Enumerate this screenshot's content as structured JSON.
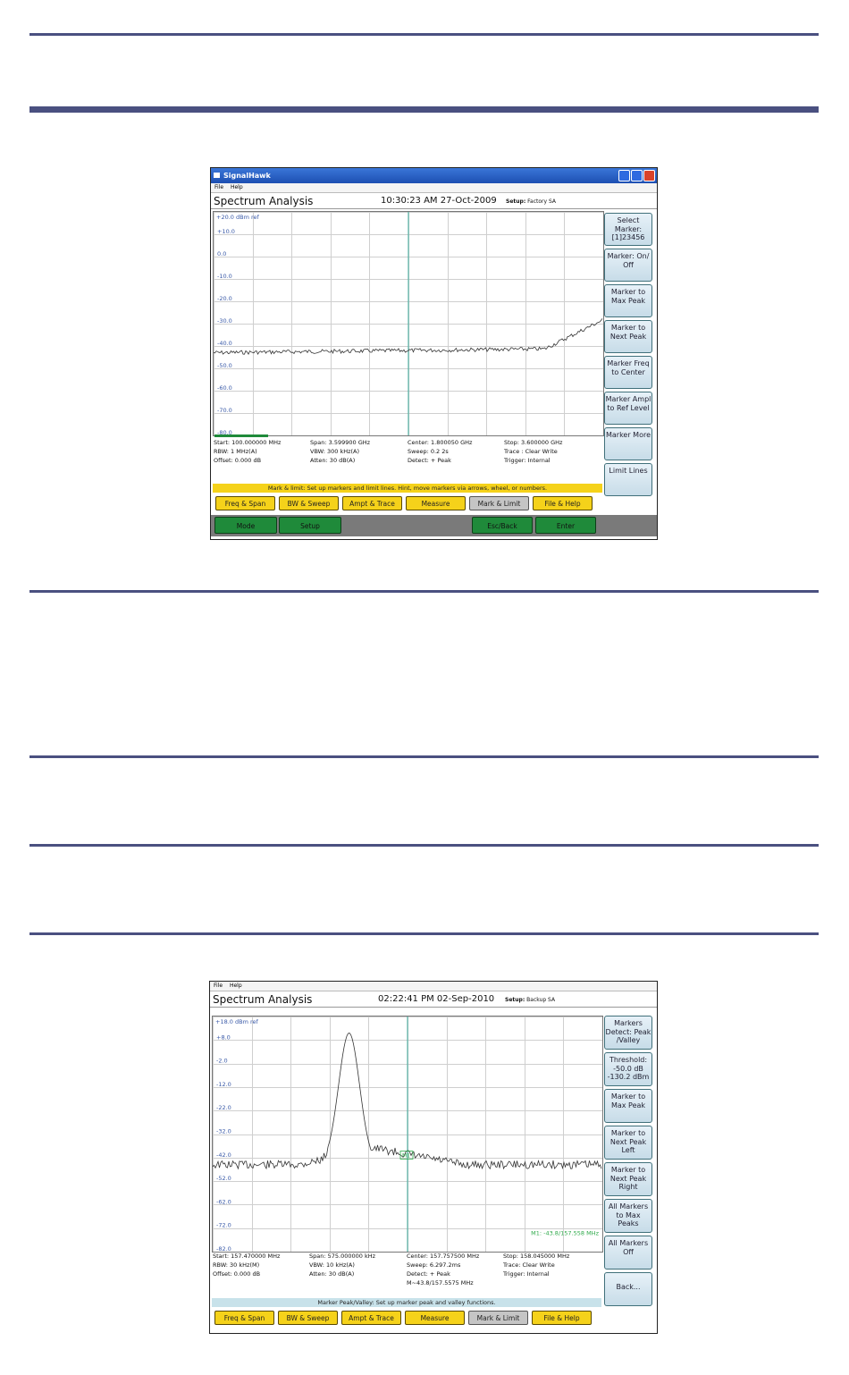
{
  "shot1": {
    "window_title": "SignalHawk",
    "menu": [
      "File",
      "Help"
    ],
    "screen_title": "Spectrum Analysis",
    "time": "10:30:23 AM 27-Oct-2009",
    "setup_label": "Setup:",
    "setup_value": "Factory SA",
    "ref_label": "+20.0 dBm ref",
    "y_labels": [
      "+10.0",
      "0.0",
      "-10.0",
      "-20.0",
      "-30.0",
      "-40.0",
      "-50.0",
      "-60.0",
      "-70.0",
      "-80.0"
    ],
    "softkeys": [
      "Select Marker: [1]23456",
      "Marker: On/ Off",
      "Marker to Max Peak",
      "Marker to Next Peak",
      "Marker Freq to Center",
      "Marker Ampl to Ref Level",
      "Marker More",
      "Limit Lines"
    ],
    "params": {
      "start": "Start: 100.000000 MHz",
      "rbw": "RBW: 1 MHz(A)",
      "offset": "Offset: 0.000 dB",
      "span": "Span: 3.599900 GHz",
      "vbw": "VBW: 300 kHz(A)",
      "atten": "Atten: 30 dB(A)",
      "center": "Center: 1.800050 GHz",
      "sweep": "Sweep: 0.2 2s",
      "detect": "Detect: + Peak",
      "stop": "Stop: 3.600000 GHz",
      "trace": "Trace : Clear Write",
      "trigger": "Trigger: Internal"
    },
    "status": "Mark & limit: Set up markers and limit lines. Hint, move markers via arrows, wheel, or numbers.",
    "tabs": [
      "Freq & Span",
      "BW & Sweep",
      "Ampt & Trace",
      "Measure",
      "Mark & Limit",
      "File & Help"
    ],
    "bottom_buttons": [
      "Mode",
      "Setup",
      "Esc/Back",
      "Enter"
    ]
  },
  "shot2": {
    "menu": [
      "File",
      "Help"
    ],
    "screen_title": "Spectrum Analysis",
    "time": "02:22:41 PM 02-Sep-2010",
    "setup_label": "Setup:",
    "setup_value": "Backup SA",
    "ref_label": "+18.0 dBm ref",
    "y_labels": [
      "+8.0",
      "-2.0",
      "-12.0",
      "-22.0",
      "-32.0",
      "-42.0",
      "-52.0",
      "-62.0",
      "-72.0",
      "-82.0"
    ],
    "marker_tag": "M1",
    "marker_readout": "M1: -43.8/157.558 MHz",
    "softkeys": [
      "Markers Detect: Peak /Valley",
      "Threshold: -50.0 dB -130.2 dBm",
      "Marker to Max Peak",
      "Marker to Next Peak Left",
      "Marker to Next Peak Right",
      "All Markers to Max Peaks",
      "All Markers Off",
      "Back..."
    ],
    "params": {
      "start": "Start: 157.470000 MHz",
      "rbw": "RBW: 30 kHz(M)",
      "offset": "Offset: 0.000 dB",
      "span": "Span: 575.000000 kHz",
      "vbw": "VBW: 10 kHz(A)",
      "atten": "Atten: 30 dB(A)",
      "center": "Center: 157.757500 MHz",
      "sweep": "Sweep: 6.297.2ms",
      "detect": "Detect: + Peak",
      "marker": "M~43.8/157.5575 MHz",
      "stop": "Stop: 158.045000 MHz",
      "trace": "Trace: Clear Write",
      "trigger": "Trigger: Internal"
    },
    "status": "Marker Peak/Valley: Set up marker peak and valley functions.",
    "tabs": [
      "Freq & Span",
      "BW & Sweep",
      "Ampt & Trace",
      "Measure",
      "Mark & Limit",
      "File & Help"
    ]
  },
  "colors": {
    "rule": "#4a5080",
    "trace": "#333333",
    "grid": "#cfcfcf",
    "center_line": "#3aaa9a",
    "tab": "#f5d21a",
    "green_button": "#1f8a3a",
    "softkey": "#d6e6ef"
  }
}
